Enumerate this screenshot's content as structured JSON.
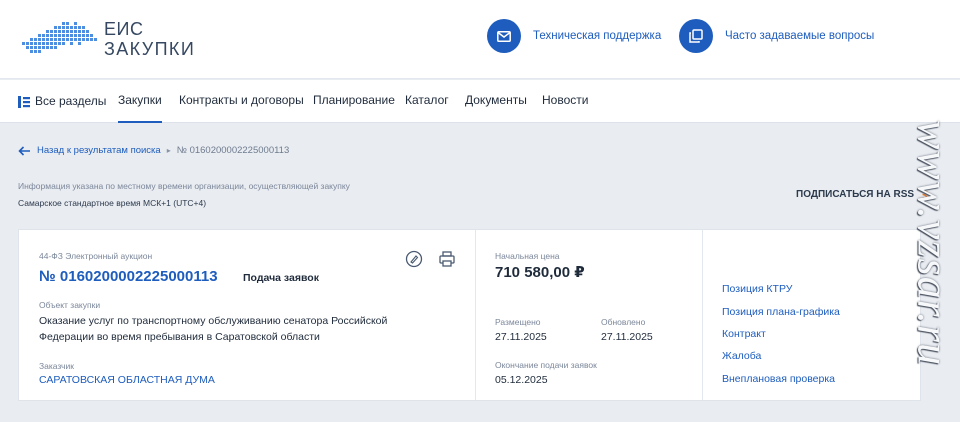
{
  "header": {
    "logo": {
      "line1": "ЕИС",
      "line2": "ЗАКУПКИ"
    },
    "support_label": "Техническая поддержка",
    "faq_label": "Часто задаваемые вопросы"
  },
  "nav": {
    "items": [
      {
        "label": "Все разделы"
      },
      {
        "label": "Закупки",
        "active": true
      },
      {
        "label": "Контракты и договоры"
      },
      {
        "label": "Планирование"
      },
      {
        "label": "Каталог"
      },
      {
        "label": "Документы"
      },
      {
        "label": "Новости"
      }
    ]
  },
  "breadcrumb": {
    "back_label": "Назад к результатам поиска",
    "current": "№ 0160200002225000113"
  },
  "info": {
    "line1": "Информация указана по местному времени организации, осуществляющей закупку",
    "line2": "Самарское стандартное время МСК+1 (UTC+4)"
  },
  "rss_label": "ПОДПИСАТЬСЯ НА RSS",
  "purchase": {
    "law_type": "44-ФЗ  Электронный аукцион",
    "number": "№ 0160200002225000113",
    "status": "Подача заявок",
    "object_label": "Объект закупки",
    "object_text": "Оказание услуг по транспортному обслуживанию сенатора Российской Федерации во время пребывания в Саратовской области",
    "customer_label": "Заказчик",
    "customer": "САРАТОВСКАЯ ОБЛАСТНАЯ ДУМА",
    "price_label": "Начальная цена",
    "price": "710 580,00 ₽",
    "posted_label": "Размещено",
    "posted": "27.11.2025",
    "updated_label": "Обновлено",
    "updated": "27.11.2025",
    "deadline_label": "Окончание подачи заявок",
    "deadline": "05.12.2025"
  },
  "links": [
    {
      "label": "Позиция КТРУ"
    },
    {
      "label": "Позиция плана-графика"
    },
    {
      "label": "Контракт"
    },
    {
      "label": "Жалоба"
    },
    {
      "label": "Внеплановая проверка"
    }
  ],
  "watermark": "www.vzsar.ru",
  "colors": {
    "accent": "#1e5dbd",
    "background": "#e9ecf1",
    "rss": "#f27c2a"
  }
}
